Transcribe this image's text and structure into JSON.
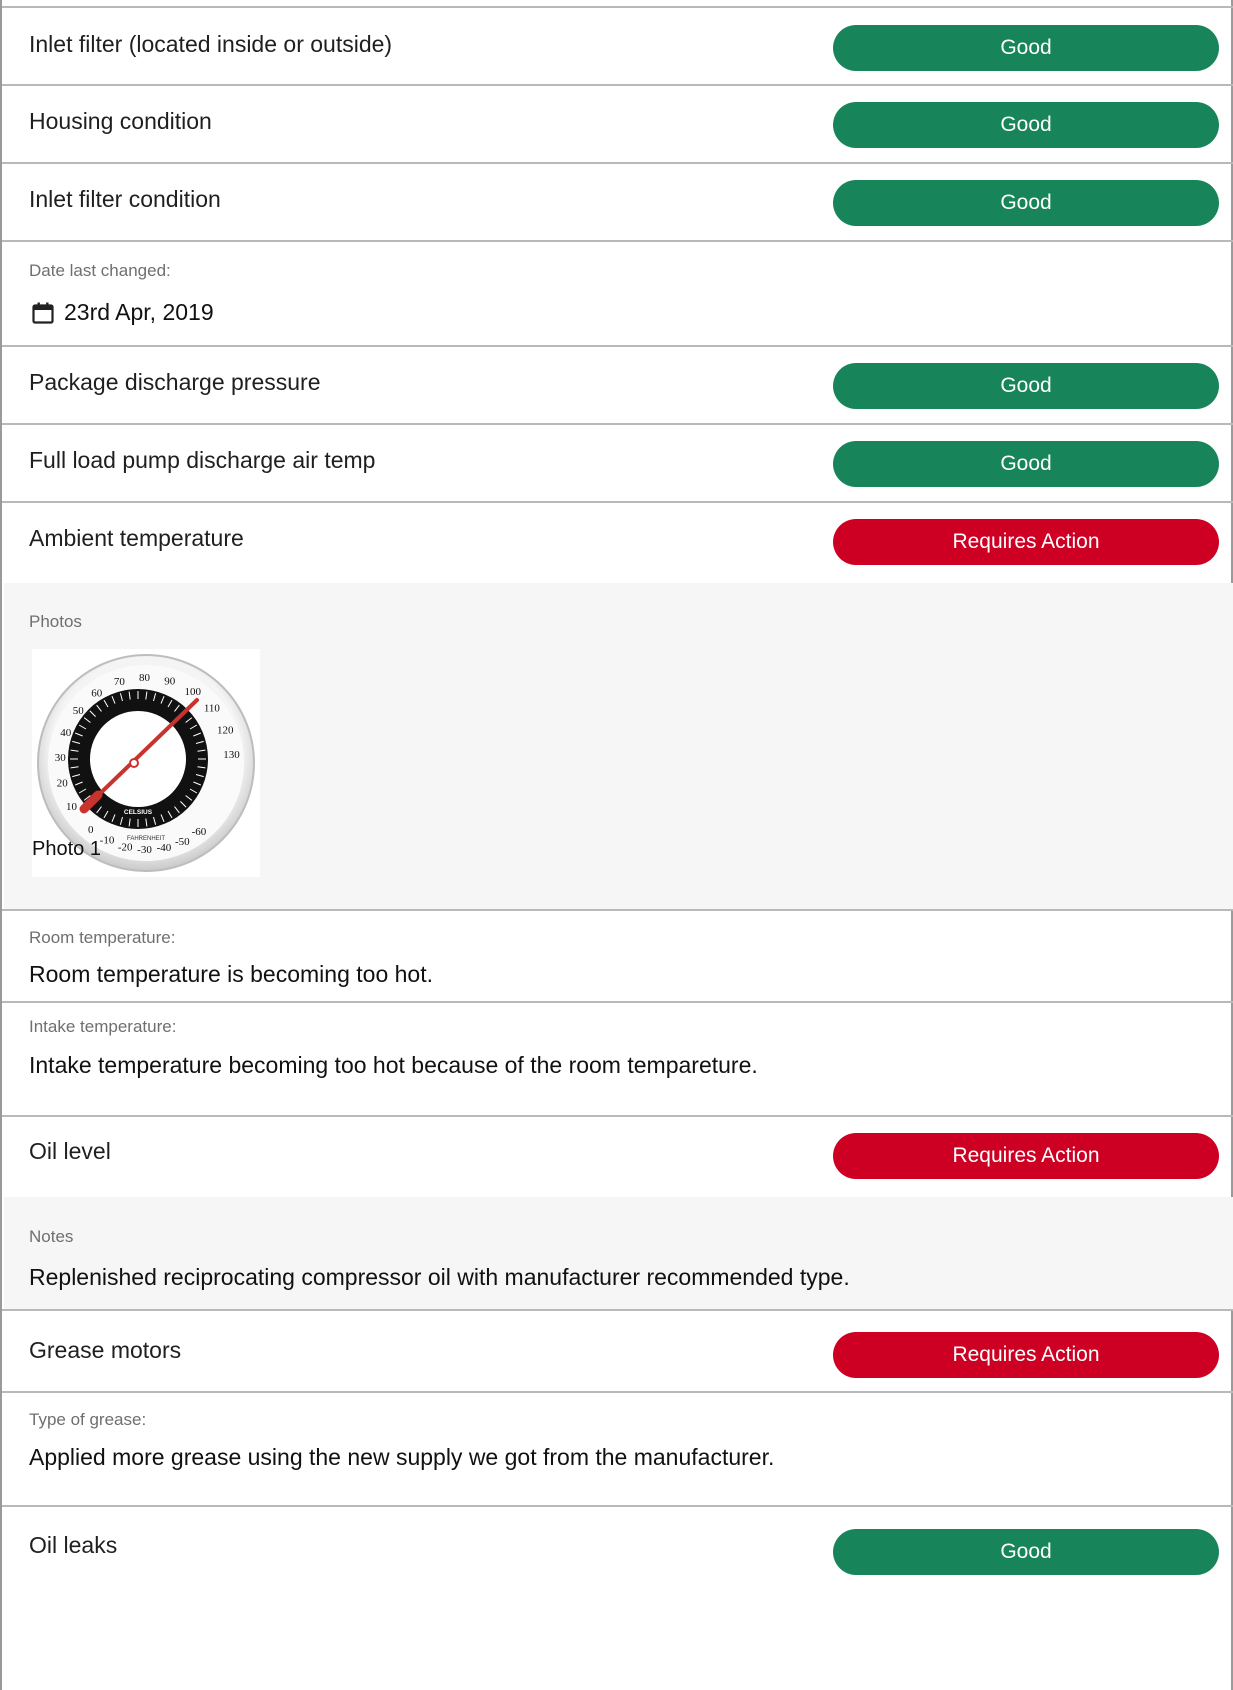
{
  "rows": {
    "inlet_filter": {
      "label": "Inlet filter (located inside or outside)",
      "status": "Good"
    },
    "housing": {
      "label": "Housing condition",
      "status": "Good"
    },
    "inlet_condition": {
      "label": "Inlet filter condition",
      "status": "Good"
    },
    "date_changed": {
      "caption": "Date last changed:",
      "value": "23rd Apr, 2019"
    },
    "package_pressure": {
      "label": "Package discharge pressure",
      "status": "Good"
    },
    "pump_temp": {
      "label": "Full load pump discharge air temp",
      "status": "Good"
    },
    "ambient": {
      "label": "Ambient temperature",
      "status": "Requires Action"
    },
    "photos": {
      "caption": "Photos",
      "photo_label": "Photo 1"
    },
    "room_temp": {
      "caption": "Room temperature:",
      "value": "Room temperature is becoming too hot."
    },
    "intake_temp": {
      "caption": "Intake temperature:",
      "value": "Intake temperature becoming too hot because of the room tempareture."
    },
    "oil_level": {
      "label": "Oil level",
      "status": "Requires Action"
    },
    "notes": {
      "caption": "Notes",
      "value": "Replenished reciprocating compressor oil with manufacturer recommended type."
    },
    "grease": {
      "label": "Grease motors",
      "status": "Requires Action"
    },
    "grease_type": {
      "caption": "Type of grease:",
      "value": "Applied more grease using the new supply we got from the manufacturer."
    },
    "oil_leaks": {
      "label": "Oil leaks",
      "status": "Good"
    }
  },
  "thermometer": {
    "outer_ticks": [
      "10",
      "20",
      "30",
      "40",
      "50",
      "60",
      "70",
      "80",
      "90",
      "100",
      "110",
      "120",
      "130",
      "0",
      "-10",
      "-20",
      "-30",
      "-40",
      "-50",
      "-60"
    ],
    "inner_label": "CELSIUS",
    "outer_label": "FAHRENHEIT"
  },
  "colors": {
    "good": "#178559",
    "requires_action": "#cd0024"
  }
}
